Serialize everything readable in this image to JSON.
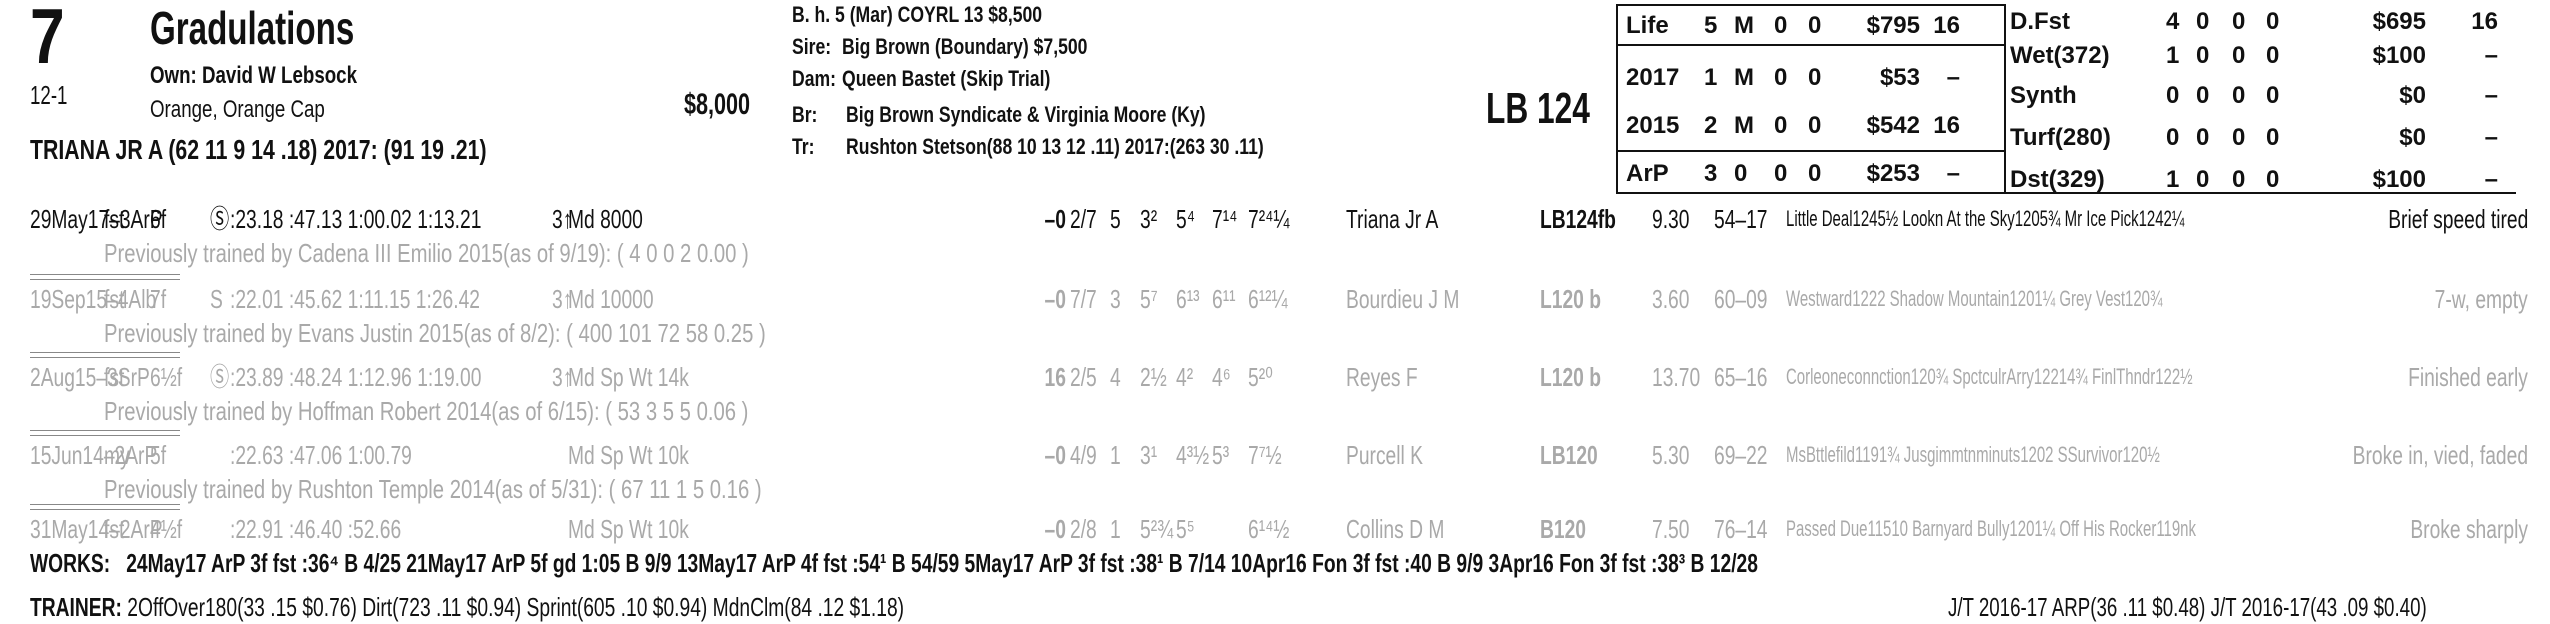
{
  "horse": {
    "program_number": "7",
    "name": "Gradulations",
    "odds": "12-1",
    "owner": "Own: David W Lebsock",
    "silks": "Orange, Orange Cap",
    "price": "$8,000",
    "jockey_line": "TRIANA JR A (62 11 9 14 .18) 2017: (91 19 .21)",
    "weight": "LB 124"
  },
  "breeding": {
    "line1": "B. h. 5 (Mar) COYRL 13 $8,500",
    "sire_label": "Sire:",
    "sire": "Big Brown (Boundary) $7,500",
    "dam_label": "Dam:",
    "dam": "Queen Bastet (Skip Trial)",
    "breeder_label": "Br:",
    "breeder": "Big Brown Syndicate & Virginia Moore (Ky)",
    "trainer_label": "Tr:",
    "trainer": "Rushton Stetson(88 10 13 12 .11) 2017:(263 30 .11)"
  },
  "stats_left": [
    {
      "label": "Life",
      "c1": "5",
      "c2": "M",
      "c3": "0",
      "c4": "0",
      "earn": "$795",
      "fig": "16"
    },
    {
      "label": "2017",
      "c1": "1",
      "c2": "M",
      "c3": "0",
      "c4": "0",
      "earn": "$53",
      "fig": "–"
    },
    {
      "label": "2015",
      "c1": "2",
      "c2": "M",
      "c3": "0",
      "c4": "0",
      "earn": "$542",
      "fig": "16"
    },
    {
      "label": "ArP",
      "c1": "3",
      "c2": "0",
      "c3": "0",
      "c4": "0",
      "earn": "$253",
      "fig": "–"
    }
  ],
  "stats_right": [
    {
      "label": "D.Fst",
      "c1": "4",
      "c2": "0",
      "c3": "0",
      "c4": "0",
      "earn": "$695",
      "fig": "16"
    },
    {
      "label": "Wet(372)",
      "c1": "1",
      "c2": "0",
      "c3": "0",
      "c4": "0",
      "earn": "$100",
      "fig": "–"
    },
    {
      "label": "Synth",
      "c1": "0",
      "c2": "0",
      "c3": "0",
      "c4": "0",
      "earn": "$0",
      "fig": "–"
    },
    {
      "label": "Turf(280)",
      "c1": "0",
      "c2": "0",
      "c3": "0",
      "c4": "0",
      "earn": "$0",
      "fig": "–"
    },
    {
      "label": "Dst(329)",
      "c1": "1",
      "c2": "0",
      "c3": "0",
      "c4": "0",
      "earn": "$100",
      "fig": "–"
    }
  ],
  "races": [
    {
      "date": "29May17–3ArP",
      "cond": "fst",
      "dist": "6f",
      "s": "Ⓢ",
      "fractions": ":23.18  :47.13  1:00.02  1:13.21",
      "age": "3↑",
      "rtype": "Md 8000",
      "fig": "–0",
      "pp": "2/7",
      "st": "5",
      "c1": "3²",
      "c2": "5⁴",
      "c3": "7¹⁴",
      "fin": "7²⁴¼",
      "jockey": "Triana Jr A",
      "wt": "LB124fb",
      "odds": "9.30",
      "trk": "54–17",
      "comp": "Little Deal1245½ Lookn At the Sky1205¾ Mr Ice Pick1242¼",
      "comment": "Brief speed tired",
      "note": "Previously trained by Cadena III Emilio 2015(as of 9/19): ( 4 0 0 2 0.00 )"
    },
    {
      "date": "19Sep15–4Alb",
      "cond": "fst",
      "dist": "7f",
      "s": "S",
      "fractions": ":22.01  :45.62  1:11.15  1:26.42",
      "age": "3↑",
      "rtype": "Md 10000",
      "fig": "–0",
      "pp": "7/7",
      "st": "3",
      "c1": "5⁷",
      "c2": "6¹³",
      "c3": "6¹¹",
      "fin": "6¹²¼",
      "jockey": "Bourdieu J M",
      "wt": "L120 b",
      "odds": "3.60",
      "trk": "60–09",
      "comp": "Westward1222 Shadow Mountain1201¼ Grey Vest120¾",
      "comment": "7-w, empty",
      "note": "Previously trained by Evans Justin 2015(as of 8/2): ( 400 101 72 58 0.25 )"
    },
    {
      "date": "2Aug15–3SrP",
      "cond": "fst",
      "dist": "6½f",
      "s": "Ⓢ",
      "fractions": ":23.89  :48.24  1:12.96  1:19.00",
      "age": "3↑",
      "rtype": "Md Sp Wt 14k",
      "fig": "16",
      "pp": "2/5",
      "st": "4",
      "c1": "2½",
      "c2": "4²",
      "c3": "4⁶",
      "fin": "5²⁰",
      "jockey": "Reyes F",
      "wt": "L120 b",
      "odds": "13.70",
      "trk": "65–16",
      "comp": "Corleoneconnction120¾ SpctculrArry12214¾ FinlThndr122½",
      "comment": "Finished early",
      "note": "Previously trained by Hoffman Robert 2014(as of 6/15): ( 53 3 5 5 0.06 )"
    },
    {
      "date": "15Jun14–2ArP",
      "cond": "my",
      "dist": "5f",
      "s": "",
      "fractions": ":22.63  :47.06  1:00.79",
      "age": "",
      "rtype": "Md Sp Wt 10k",
      "fig": "–0",
      "pp": "4/9",
      "st": "1",
      "c1": "3¹",
      "c2": "4³½",
      "c3": "5³",
      "fin": "7⁷½",
      "jockey": "Purcell K",
      "wt": "LB120",
      "odds": "5.30",
      "trk": "69–22",
      "comp": "MsBttlefild1191¾ Jusgimmtnminuts1202 SSurvivor120½",
      "comment": "Broke in, vied, faded",
      "note": "Previously trained by Rushton Temple 2014(as of 5/31): ( 67 11 1 5 0.16 )"
    },
    {
      "date": "31May14–2ArP",
      "cond": "fst",
      "dist": "4½f",
      "s": "",
      "fractions": ":22.91  :46.40  :52.66",
      "age": "",
      "rtype": "Md Sp Wt 10k",
      "fig": "–0",
      "pp": "2/8",
      "st": "1",
      "c1": "5²¾",
      "c2": "5⁵",
      "c3": "",
      "fin": "6¹⁴½",
      "jockey": "Collins D M",
      "wt": "B120",
      "odds": "7.50",
      "trk": "76–14",
      "comp": "Passed Due11510 Barnyard Bully1201¼ Off His Rocker119nk",
      "comment": "Broke sharply",
      "note": ""
    }
  ],
  "works": {
    "label": "WORKS:",
    "text": "24May17 ArP 3f fst :36⁴ B 4/25   21May17 ArP 5f gd 1:05 B 9/9   13May17 ArP 4f fst :54¹ B 54/59   5May17 ArP 3f fst :38¹ B 7/14   10Apr16 Fon 3f fst :40 B 9/9   3Apr16 Fon 3f fst :38³ B 12/28"
  },
  "trainer_stats": {
    "label": "TRAINER:",
    "text": "2OffOver180(33 .15 $0.76) Dirt(723 .11 $0.94) Sprint(605 .10 $0.94) MdnClm(84 .12 $1.18)",
    "jt": "J/T 2016-17 ARP(36 .11 $0.48)  J/T 2016-17(43 .09 $0.40)"
  }
}
